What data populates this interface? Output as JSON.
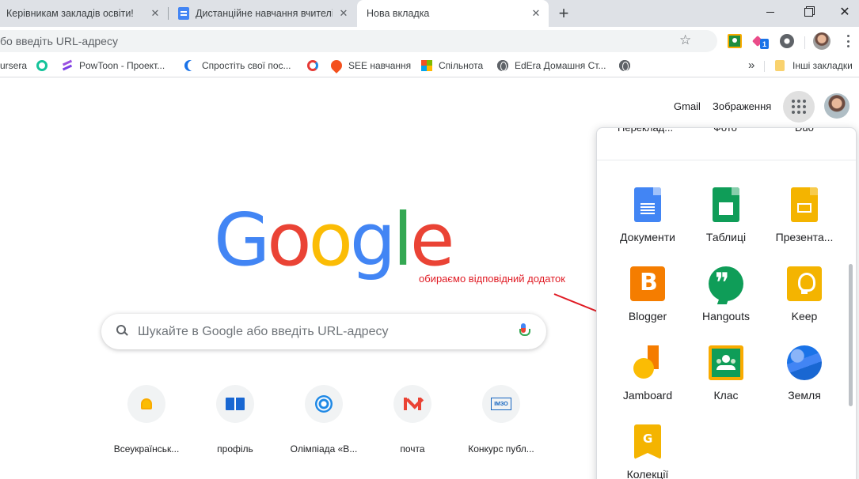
{
  "tabs": [
    {
      "title": "Керівникам закладів освіти!",
      "active": false
    },
    {
      "title": "Дистанційне навчання вчителів",
      "active": false
    },
    {
      "title": "Нова вкладка",
      "active": true
    }
  ],
  "tab_close_symbol": "✕",
  "new_tab_symbol": "+",
  "omnibox": {
    "text": "бо введіть URL-адресу"
  },
  "extensions": {
    "screencast_badge": "1"
  },
  "bookmarks": [
    {
      "label": "ursera",
      "icon": "coursera-icon"
    },
    {
      "label": "",
      "icon": "grammarly-icon"
    },
    {
      "label": "PowToon - Проект...",
      "icon": "powtoon-icon"
    },
    {
      "label": "Спростіть свої пос...",
      "icon": "crescent-icon"
    },
    {
      "label": "",
      "icon": "sync-icon"
    },
    {
      "label": "SEE навчання",
      "icon": "see-icon"
    },
    {
      "label": "Спільнота",
      "icon": "microsoft-icon"
    },
    {
      "label": "EdEra Домашня Ст...",
      "icon": "globe-icon"
    },
    {
      "label": "",
      "icon": "globe-icon"
    }
  ],
  "bookmarks_more": "»",
  "other_bookmarks": "Інші закладки",
  "header": {
    "gmail": "Gmail",
    "images": "Зображення"
  },
  "logo": [
    "G",
    "o",
    "o",
    "g",
    "l",
    "e"
  ],
  "logo_colors": [
    "#4285f4",
    "#ea4335",
    "#fbbc05",
    "#4285f4",
    "#34a853",
    "#ea4335"
  ],
  "annotation": "обираємо відповідний додаток",
  "annotation_color": "#e01b24",
  "search": {
    "placeholder": "Шукайте в Google або введіть URL-адресу"
  },
  "shortcuts": [
    {
      "label": "Всеукраїнськ...",
      "icon": "bell-icon"
    },
    {
      "label": "профіль",
      "icon": "book-icon"
    },
    {
      "label": "Олімпіада «В...",
      "icon": "snowflake-icon"
    },
    {
      "label": "почта",
      "icon": "gmail-icon"
    },
    {
      "label": "Конкурс публ...",
      "icon": "imzo-icon"
    }
  ],
  "shortcut_imzo_text": "ІМЗО",
  "apps_panel": {
    "cut_off": [
      "Переклад...",
      "Фото",
      "Duo"
    ],
    "apps": [
      {
        "label": "Документи",
        "icon": "docs-icon"
      },
      {
        "label": "Таблиці",
        "icon": "sheets-icon"
      },
      {
        "label": "Презента...",
        "icon": "slides-icon"
      },
      {
        "label": "Blogger",
        "icon": "blogger-icon"
      },
      {
        "label": "Hangouts",
        "icon": "hangouts-icon"
      },
      {
        "label": "Keep",
        "icon": "keep-icon"
      },
      {
        "label": "Jamboard",
        "icon": "jamboard-icon"
      },
      {
        "label": "Клас",
        "icon": "classroom-icon"
      },
      {
        "label": "Земля",
        "icon": "earth-icon"
      },
      {
        "label": "Колекції",
        "icon": "collections-icon"
      }
    ]
  }
}
